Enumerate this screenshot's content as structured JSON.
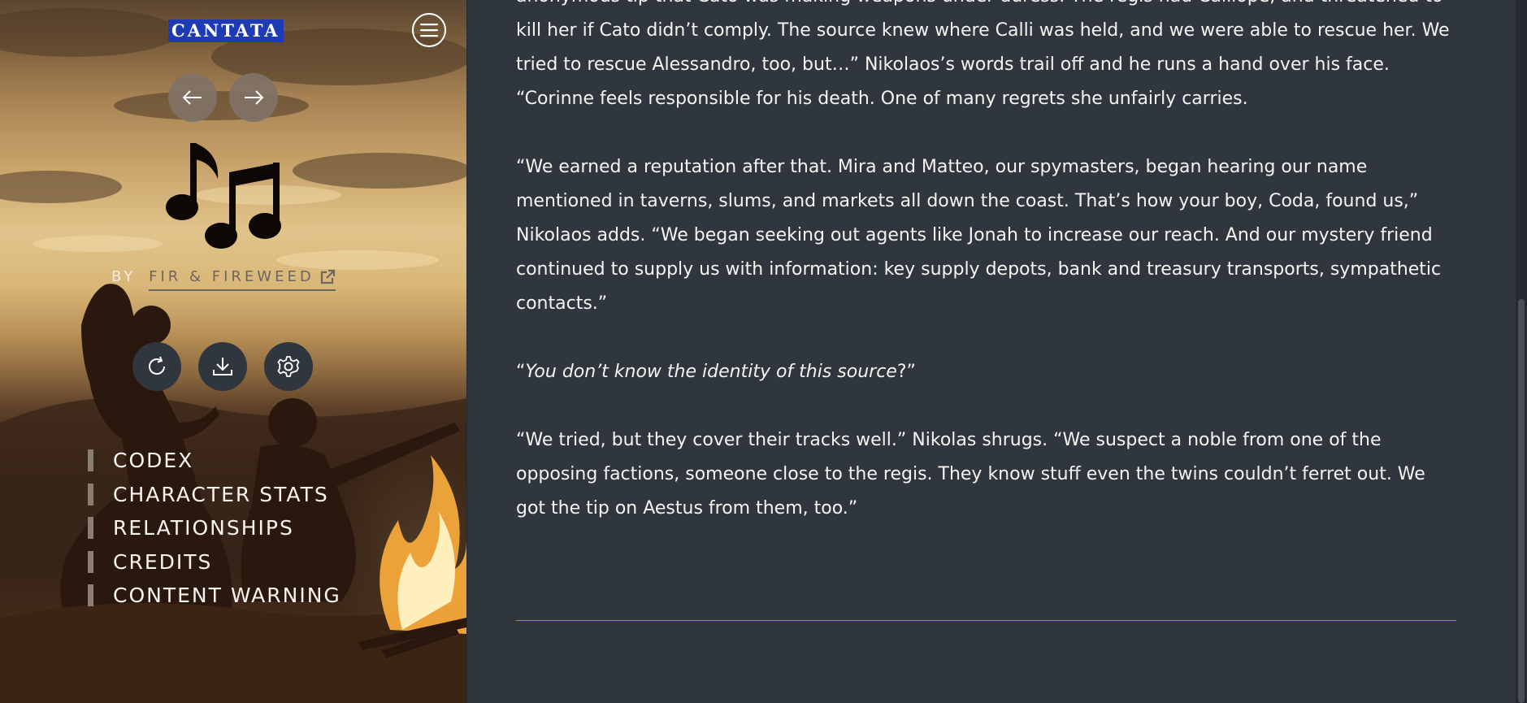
{
  "sidebar": {
    "site_title": "CANTATA",
    "byline_prefix": "BY",
    "author": "FIR & FIREWEED",
    "nav": [
      {
        "label": "CODEX"
      },
      {
        "label": "CHARACTER STATS"
      },
      {
        "label": "RELATIONSHIPS"
      },
      {
        "label": "CREDITS"
      },
      {
        "label": "CONTENT WARNING"
      }
    ],
    "icons": {
      "menu": "hamburger-menu-icon",
      "back": "arrow-left-icon",
      "forward": "arrow-right-icon",
      "restart": "restart-icon",
      "save": "download-icon",
      "settings": "gear-icon",
      "logo": "music-notes-icon",
      "external": "external-link-icon"
    }
  },
  "story": {
    "p1": "anonymous tip that Cato was making weapons under duress. The regis had Calliope, and threatened to kill her if Cato didn’t comply. The source knew where Calli was held, and we were able to rescue her. We tried to rescue Alessandro, too, but…” Nikolaos’s words trail off and he runs a hand over his face. “Corinne feels responsible for his death. One of many regrets she unfairly carries.",
    "p2": "“We earned a reputation after that. Mira and Matteo, our spymasters, began hearing our name mentioned in taverns, slums, and markets all down the coast. That’s how your boy, Coda, found us,” Nikolaos adds. “We began seeking out agents like Jonah to increase our reach. And our mystery friend continued to supply us with information: key supply depots, bank and treasury transports, sympathetic contacts.”",
    "p3_open": "“",
    "p3_italic": "You don’t know the identity of this source",
    "p3_close": "?”",
    "p4": "“We tried, but they cover their tracks well.” Nikolas shrugs. “We suspect a noble from one of the opposing factions, someone close to the regis. They know stuff even the twins couldn’t ferret out. We got the tip on Aestus from them, too.”"
  },
  "colors": {
    "page_background": "#30363e",
    "title_highlight": "#1e3bb5",
    "divider": "#a8923f",
    "text": "#f6f4f1"
  }
}
